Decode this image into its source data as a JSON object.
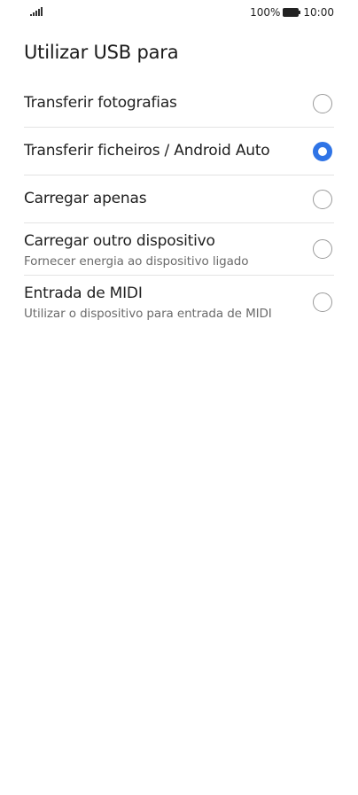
{
  "status_bar": {
    "signal_icon": "signal-bars-icon",
    "battery_percent": "100%",
    "battery_icon": "battery-full-icon",
    "time": "10:00"
  },
  "page": {
    "title": "Utilizar USB para"
  },
  "options": [
    {
      "title": "Transferir fotografias",
      "subtitle": "",
      "selected": false
    },
    {
      "title": "Transferir ficheiros / Android Auto",
      "subtitle": "",
      "selected": true
    },
    {
      "title": "Carregar apenas",
      "subtitle": "",
      "selected": false
    },
    {
      "title": "Carregar outro dispositivo",
      "subtitle": "Fornecer energia ao dispositivo ligado",
      "selected": false
    },
    {
      "title": "Entrada de MIDI",
      "subtitle": "Utilizar o dispositivo para entrada de MIDI",
      "selected": false
    }
  ],
  "colors": {
    "accent": "#2f74e6",
    "divider": "#e3e3e3",
    "subtitle": "#6b6b6b"
  }
}
